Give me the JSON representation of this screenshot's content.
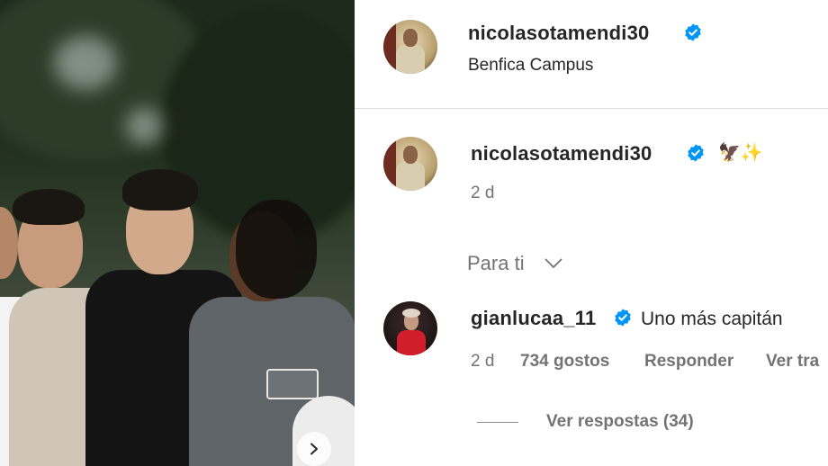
{
  "post_header": {
    "username": "nicolasotamendi30",
    "location": "Benfica Campus"
  },
  "caption": {
    "username": "nicolasotamendi30",
    "emojis": "🦅✨",
    "time": "2 d"
  },
  "sort": {
    "label": "Para ti"
  },
  "comment": {
    "username": "gianlucaa_11",
    "text": "Uno más capitán",
    "time": "2 d",
    "likes": "734 gostos",
    "reply_label": "Responder",
    "translate_label": "Ver tra",
    "view_replies_label": "Ver respostas (34)"
  },
  "colors": {
    "verified_blue": "#0095f6",
    "text_primary": "#262626",
    "text_muted": "#737373"
  },
  "icons": [
    "verified-badge-icon",
    "chevron-down-icon",
    "chevron-right-icon"
  ]
}
